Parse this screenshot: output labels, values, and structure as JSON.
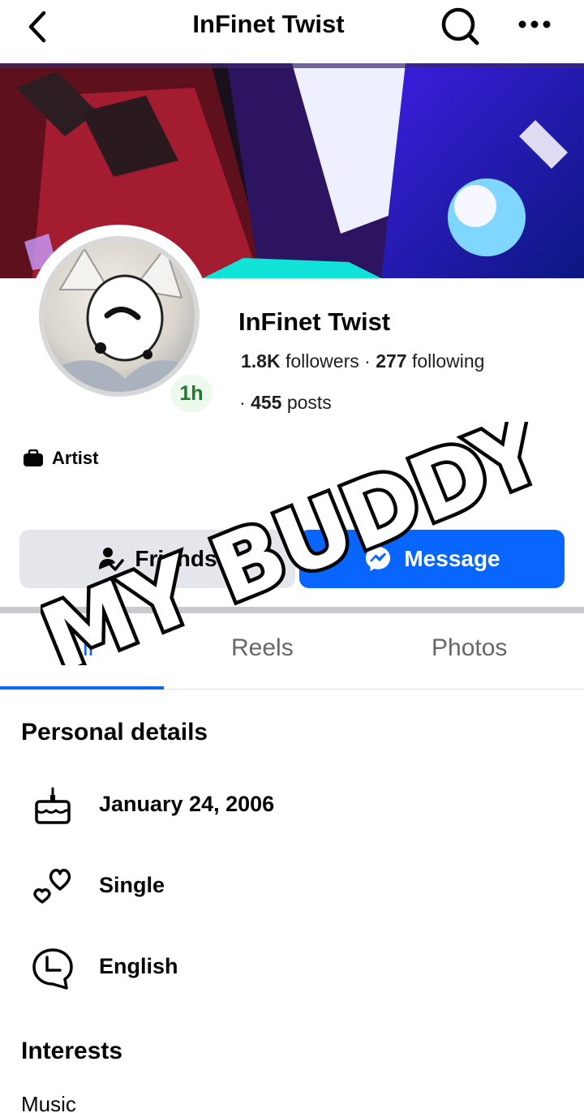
{
  "header": {
    "title": "InFinet Twist"
  },
  "profile": {
    "name": "InFinet Twist",
    "active_time": "1h",
    "followers_count": "1.8K",
    "followers_label": "followers",
    "following_count": "277",
    "following_label": "following",
    "posts_count": "455",
    "posts_label": "posts",
    "separator": "·",
    "category": "Artist"
  },
  "actions": {
    "friends_label": "Friends",
    "message_label": "Message"
  },
  "tabs": [
    {
      "label": "All"
    },
    {
      "label": "Reels"
    },
    {
      "label": "Photos"
    }
  ],
  "personal_details": {
    "title": "Personal details",
    "birthday": "January 24, 2006",
    "relationship": "Single",
    "language": "English"
  },
  "interests": {
    "title": "Interests",
    "first_item": "Music"
  },
  "sticker": {
    "text": "MY BUDDY"
  },
  "colors": {
    "accent": "#0866ff",
    "badge_green": "#1f7a2c",
    "muted": "#65676b"
  }
}
